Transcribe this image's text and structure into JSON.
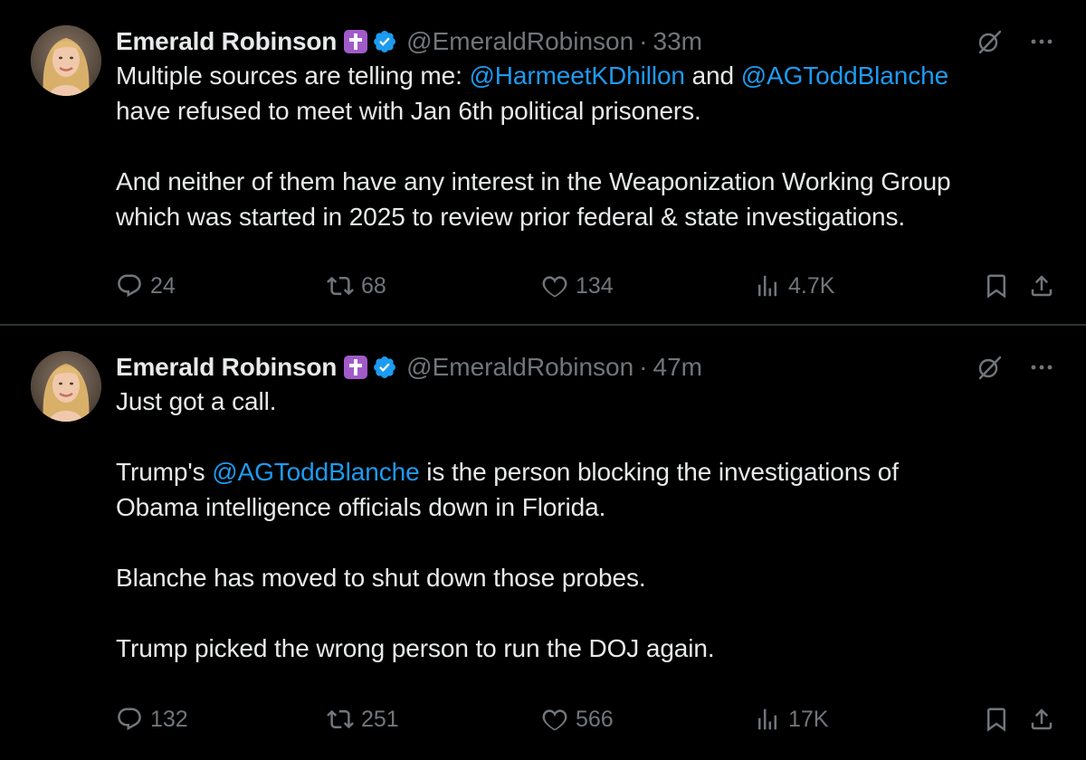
{
  "colors": {
    "background": "#000000",
    "text": "#e7e9ea",
    "muted": "#71767b",
    "mention": "#1d9bf0",
    "verified": "#1d9bf0",
    "badge": "#a05bc9",
    "divider": "#2f3336"
  },
  "tweets": [
    {
      "author": {
        "display_name": "Emerald Robinson",
        "handle": "@EmeraldRobinson",
        "separator": "·",
        "time": "33m",
        "badge_icon": "cross-badge-icon",
        "verified_icon": "verified-checkmark-icon"
      },
      "line1_pre": "Multiple sources are telling me: ",
      "mention_a": "@HarmeetKDhillon",
      "line1_mid": " and ",
      "mention_b": "@AGToddBlanche",
      "line2": "have refused to meet with Jan 6th political prisoners.",
      "para2_line1": "And neither of them have any interest in the Weaponization Working Group",
      "para2_line2": "which was started in 2025 to review prior federal & state investigations.",
      "stats": {
        "replies": "24",
        "reposts": "68",
        "likes": "134",
        "views": "4.7K"
      }
    },
    {
      "author": {
        "display_name": "Emerald Robinson",
        "handle": "@EmeraldRobinson",
        "separator": "·",
        "time": "47m",
        "badge_icon": "cross-badge-icon",
        "verified_icon": "verified-checkmark-icon"
      },
      "line1": "Just got a call.",
      "p2_pre": "Trump's ",
      "p2_mention": "@AGToddBlanche",
      "p2_post": " is the person blocking the investigations of",
      "p2_line2": "Obama intelligence officials down in Florida.",
      "p3": "Blanche has moved to shut down those probes.",
      "p4": "Trump picked the wrong person to run the DOJ again.",
      "stats": {
        "replies": "132",
        "reposts": "251",
        "likes": "566",
        "views": "17K"
      }
    }
  ]
}
